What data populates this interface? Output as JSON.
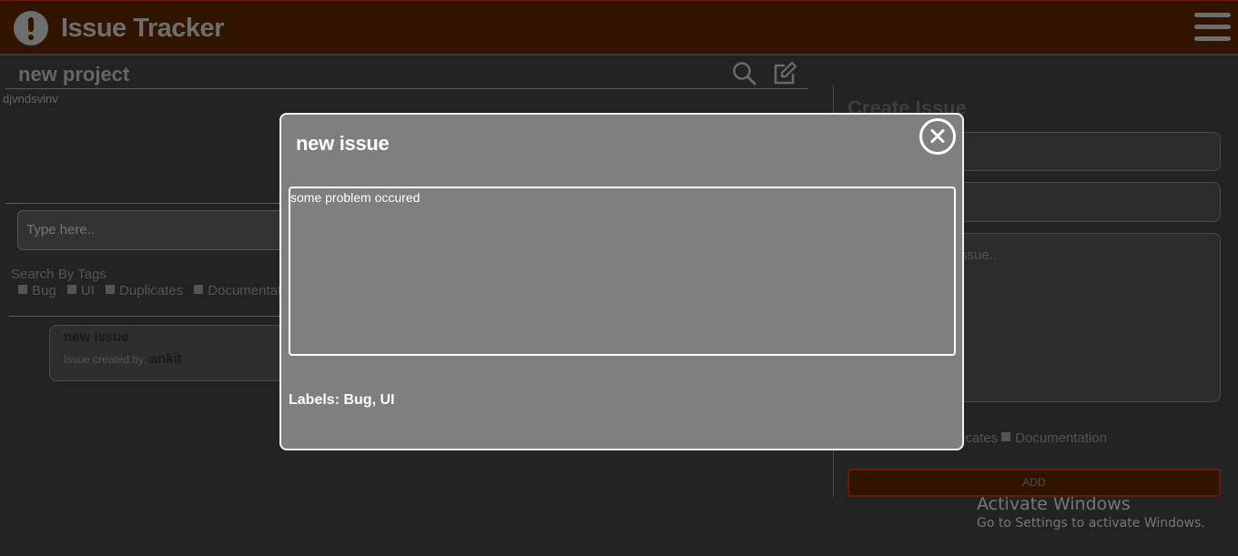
{
  "header": {
    "app_title": "Issue Tracker"
  },
  "project": {
    "name": "new project",
    "description": "djvndsvinv"
  },
  "search": {
    "placeholder": "Type here..",
    "tags_title": "Search By Tags",
    "tags": [
      "Bug",
      "UI",
      "Duplicates",
      "Documentation"
    ]
  },
  "issues": [
    {
      "name": "new issue",
      "created_by_label": "Issue created by:",
      "author": "ankit"
    }
  ],
  "create_panel": {
    "title": "Create Issue",
    "description_placeholder_partial": "ssue..",
    "tags_partial": "icates",
    "tag_documentation": "Documentation",
    "add_label": "ADD"
  },
  "modal": {
    "title": "new issue",
    "description": "some problem occured",
    "labels_text": "Labels: Bug, UI"
  },
  "os_watermark": {
    "title": "Activate Windows",
    "subtitle": "Go to Settings to activate Windows."
  },
  "colors": {
    "header_bg": "#301400",
    "page_bg": "#232323",
    "modal_bg": "#7f7f7f",
    "modal_border": "#f2f2f2"
  }
}
